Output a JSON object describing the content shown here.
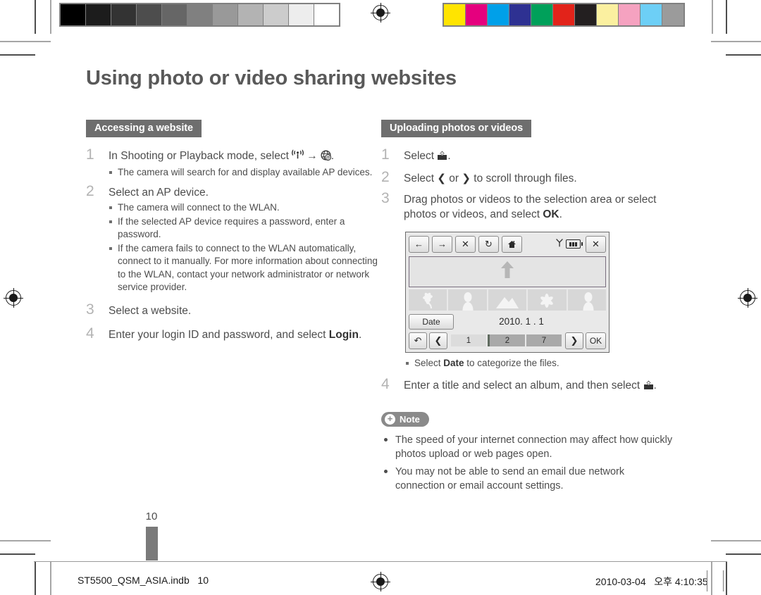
{
  "page": {
    "title": "Using photo or video sharing websites",
    "page_number": "10"
  },
  "calibration": {
    "gray_swatches": [
      "#000000",
      "#1c1c1c",
      "#333333",
      "#4d4d4d",
      "#666666",
      "#808080",
      "#999999",
      "#b3b3b3",
      "#cccccc",
      "#ededed",
      "#ffffff"
    ],
    "color_swatches": [
      "#ffe400",
      "#e5007e",
      "#00a0e9",
      "#2e3192",
      "#00a05a",
      "#e2231a",
      "#231f20",
      "#fbf0a0",
      "#f5a2c0",
      "#6dcff6",
      "#9b9b9b"
    ]
  },
  "left_column": {
    "heading": "Accessing a website",
    "steps": [
      {
        "num": "1",
        "text_before": "In Shooting or Playback mode, select ",
        "icon_1": "wifi-broadcast-icon",
        "arrow": "→",
        "icon_2": "globe-at-icon",
        "text_after": ".",
        "sub": [
          "The camera will search for and display available AP devices."
        ]
      },
      {
        "num": "2",
        "text": "Select an AP device.",
        "sub": [
          "The camera will connect to the WLAN.",
          "If the selected AP device requires a password, enter a password.",
          "If the camera fails to connect to the WLAN automatically, connect to it manually. For more information about connecting to the WLAN, contact your network administrator or network service provider."
        ]
      },
      {
        "num": "3",
        "text": "Select a website.",
        "sub": []
      },
      {
        "num": "4",
        "text_before": "Enter your login ID and password, and select ",
        "bold": "Login",
        "text_after": ".",
        "sub": []
      }
    ]
  },
  "right_column": {
    "heading": "Uploading photos or videos",
    "steps": [
      {
        "num": "1",
        "text_before": "Select ",
        "icon": "upload-icon",
        "text_after": "."
      },
      {
        "num": "2",
        "text_before": "Select ",
        "icon_left": "❮",
        "text_mid": " or ",
        "icon_right": "❯",
        "text_after": " to scroll through files."
      },
      {
        "num": "3",
        "text_before": "Drag photos or videos to the selection area or select photos or videos, and select ",
        "bold": "OK",
        "text_after": "."
      }
    ],
    "after_device_note": {
      "before": "Select ",
      "bold": "Date",
      "after": " to categorize the files."
    },
    "step4": {
      "num": "4",
      "text_before": "Enter a title and select an album, and then select ",
      "icon": "upload-icon",
      "text_after": "."
    },
    "note": {
      "label": "Note",
      "items": [
        "The speed of your internet connection may affect how quickly photos upload or web pages open.",
        "You may not be able to send an email due network connection or email account settings."
      ]
    }
  },
  "device_screen": {
    "toolbar_buttons": [
      {
        "name": "back-arrow-icon",
        "glyph": "←"
      },
      {
        "name": "forward-arrow-icon",
        "glyph": "→"
      },
      {
        "name": "stop-icon",
        "glyph": "✕"
      },
      {
        "name": "refresh-icon",
        "glyph": "↻"
      },
      {
        "name": "home-icon",
        "glyph": "⌂"
      }
    ],
    "status": {
      "signal": "wifi-antenna-icon",
      "battery": "battery-full-icon"
    },
    "close_button": "✕",
    "drop_area_icon": "⬆",
    "thumbnails": [
      "flower",
      "person",
      "mountain",
      "flower",
      "person"
    ],
    "date_button": "Date",
    "date_value": "2010. 1 . 1",
    "bottom_buttons": {
      "undo": "↶",
      "prev": "❮",
      "next": "❯",
      "ok": "OK"
    },
    "segments": [
      "1",
      "2",
      "7"
    ]
  },
  "footer": {
    "filename": "ST5500_QSM_ASIA.indb   10",
    "timestamp": "2010-03-04   오후 4:10:35"
  }
}
